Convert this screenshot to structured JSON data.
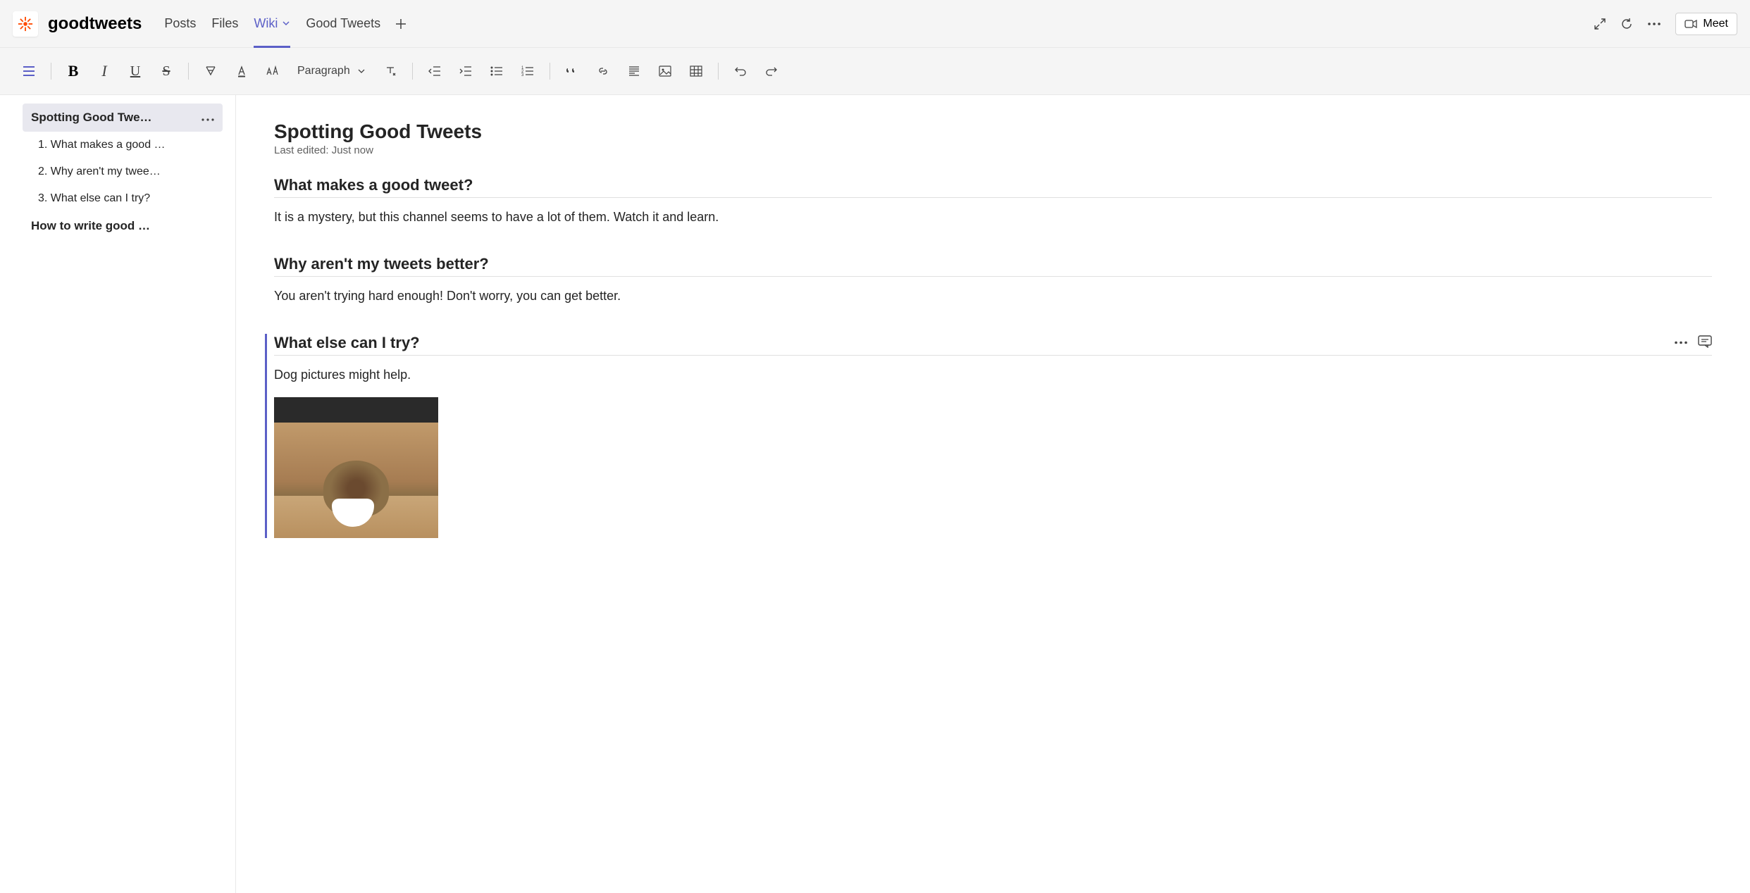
{
  "header": {
    "channel_name": "goodtweets",
    "tabs": [
      {
        "label": "Posts"
      },
      {
        "label": "Files"
      },
      {
        "label": "Wiki",
        "active": true,
        "dropdown": true
      },
      {
        "label": "Good Tweets"
      }
    ],
    "meet_label": "Meet"
  },
  "toolbar": {
    "hamburger": "hamburger-icon",
    "bold": "B",
    "italic": "I",
    "underline": "U",
    "strike": "S",
    "paragraph_label": "Paragraph"
  },
  "sidebar": {
    "pages": [
      {
        "title": "Spotting Good Twe…",
        "active": true,
        "sections": [
          "1. What makes a good …",
          "2. Why aren't my twee…",
          "3. What else can I try?"
        ]
      },
      {
        "title": "How to write good …",
        "active": false,
        "sections": []
      }
    ]
  },
  "document": {
    "title": "Spotting Good Tweets",
    "last_edited": "Last edited: Just now",
    "sections": [
      {
        "title": "What makes a good tweet?",
        "body": "It is a mystery, but this channel seems to have a lot of them. Watch it and learn.",
        "selected": false
      },
      {
        "title": "Why aren't my tweets better?",
        "body": "You aren't trying hard enough! Don't worry, you can get better.",
        "selected": false
      },
      {
        "title": "What else can I try?",
        "body": "Dog pictures might help.",
        "selected": true,
        "has_image": true
      }
    ]
  }
}
